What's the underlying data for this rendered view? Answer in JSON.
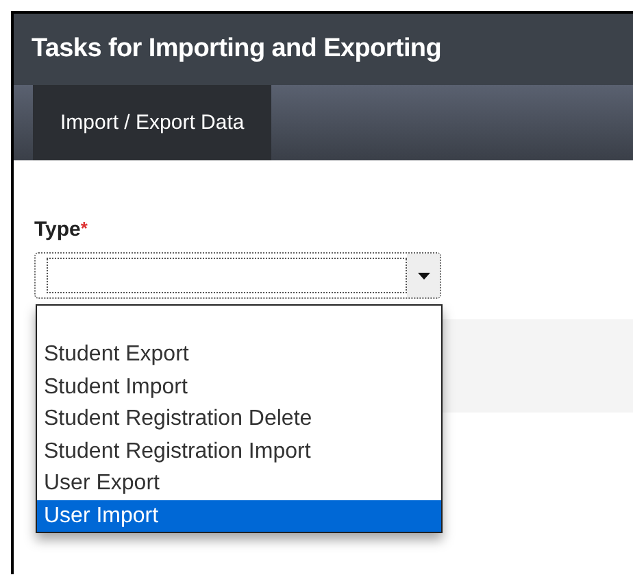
{
  "window": {
    "title": "Tasks for Importing and Exporting"
  },
  "tabs": [
    {
      "label": "Import / Export Data",
      "selected": true
    }
  ],
  "field": {
    "label": "Type",
    "required_mark": "*",
    "expanded": true,
    "options": [
      {
        "label": "Student Export",
        "selected": false
      },
      {
        "label": "Student Import",
        "selected": false
      },
      {
        "label": "Student Registration Delete",
        "selected": false
      },
      {
        "label": "Student Registration Import",
        "selected": false
      },
      {
        "label": "User Export",
        "selected": false
      },
      {
        "label": "User Import",
        "selected": true
      }
    ]
  }
}
